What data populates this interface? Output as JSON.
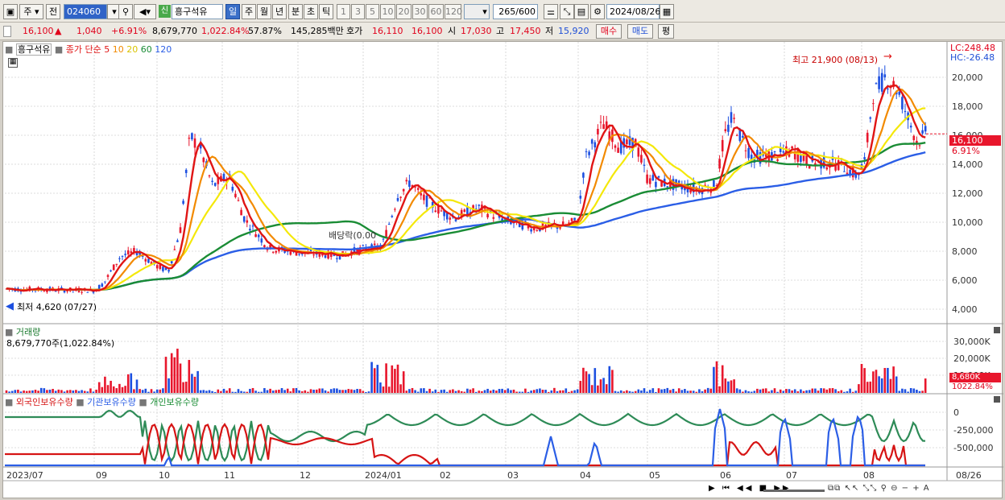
{
  "toolbar": {
    "market_label": "주",
    "prev_label": "전",
    "code": "024060",
    "new_badge": "신",
    "stock_name": "흥구석유",
    "periods": [
      "일",
      "주",
      "월",
      "년",
      "분",
      "초",
      "틱"
    ],
    "active_period": "일",
    "intervals": [
      "1",
      "3",
      "5",
      "10",
      "20",
      "30",
      "60",
      "120"
    ],
    "page_count": "265",
    "page_total": "/600",
    "date": "2024/08/26"
  },
  "quote": {
    "price": "16,100",
    "change_arrow": "▲",
    "change": "1,040",
    "change_pct": "+6.91%",
    "volume": "8,679,770",
    "volume_ratio": "1,022.84%",
    "turnover": "57.87%",
    "amount": "145,285백만",
    "bid_label": "호가",
    "bid1": "16,110",
    "bid2": "16,100",
    "open_label": "시",
    "open": "17,030",
    "high_label": "고",
    "high": "17,450",
    "low_label": "저",
    "low": "15,920",
    "buy_label": "매수",
    "sell_label": "매도",
    "avg_label": "평"
  },
  "price_panel": {
    "legend_name": "흥구석유",
    "legend_ma": "종가 단순 5",
    "legend_periods": [
      "10",
      "20",
      "60",
      "120"
    ],
    "lc": "LC:248.48",
    "hc": "HC:-26.48",
    "max_label": "최고 21,900 (08/13)",
    "min_label": "최저 4,620 (07/27)",
    "dividend_label": "배당락(0.00",
    "current_price": "16,100",
    "current_pct": "6.91%",
    "y_ticks": [
      "20,000",
      "18,000",
      "16,000",
      "14,000",
      "12,000",
      "10,000",
      "8,000",
      "6,000",
      "4,000"
    ]
  },
  "volume_panel": {
    "title": "거래량",
    "value": "8,679,770주(1,022.84%)",
    "y_ticks": [
      "30,000K",
      "20,000K",
      "10,000K"
    ],
    "current": "8,680K",
    "current_pct": "1022.84%"
  },
  "holder_panel": {
    "foreign": "외국인보유수량",
    "institution": "기관보유수량",
    "individual": "개인보유수량",
    "y_ticks": [
      "0",
      "-250,000",
      "-500,000"
    ]
  },
  "x_axis": [
    "2023/07",
    "09",
    "10",
    "11",
    "12",
    "2024/01",
    "02",
    "03",
    "04",
    "05",
    "06",
    "07",
    "08",
    "08/26"
  ],
  "colors": {
    "candle_up": "#e8162c",
    "candle_down": "#1c4fe0",
    "ma5": "#e01515",
    "ma10": "#f28a00",
    "ma20": "#f4e80a",
    "ma60": "#1a8c35",
    "ma120": "#2b5ee6"
  }
}
